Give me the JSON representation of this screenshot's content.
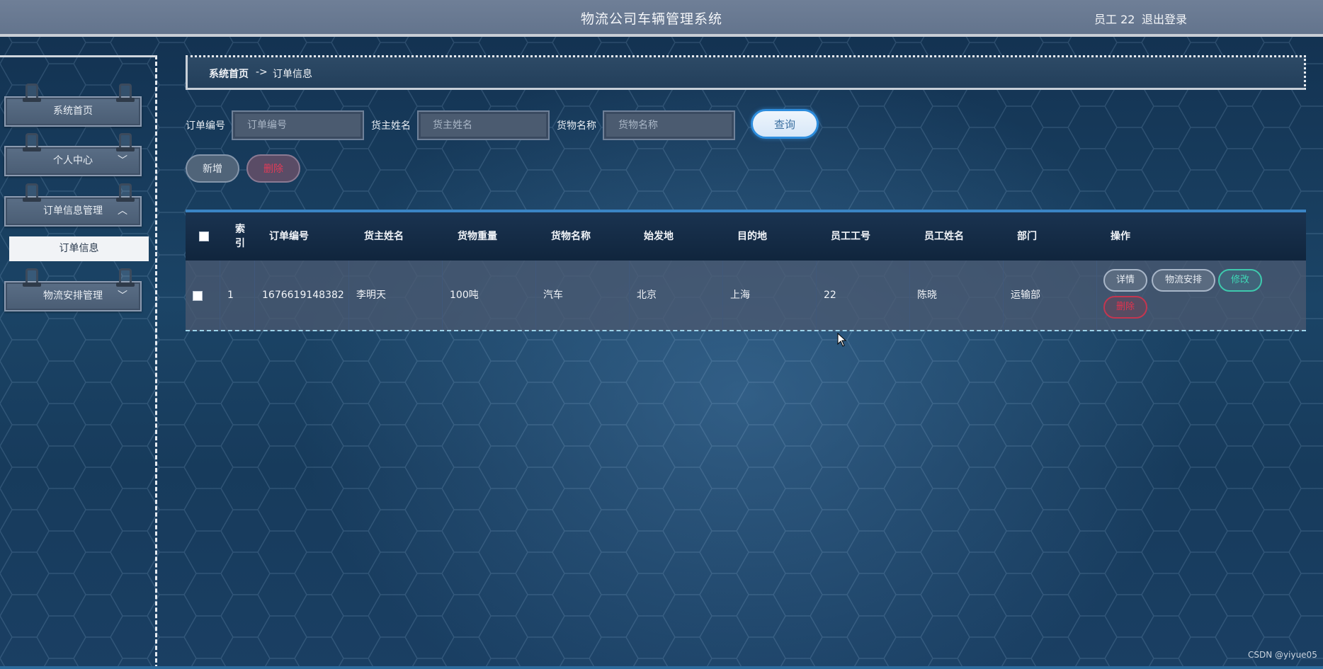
{
  "header": {
    "title": "物流公司车辆管理系统",
    "user": "员工 22",
    "logout": "退出登录"
  },
  "sidebar": {
    "items": [
      {
        "label": "系统首页"
      },
      {
        "label": "个人中心"
      },
      {
        "label": "订单信息管理"
      },
      {
        "label": "物流安排管理"
      }
    ],
    "sub_item": "订单信息"
  },
  "breadcrumb": {
    "home": "系统首页",
    "sep": "->",
    "current": "订单信息"
  },
  "search": {
    "order_no_label": "订单编号",
    "order_no_placeholder": "订单编号",
    "owner_label": "货主姓名",
    "owner_placeholder": "货主姓名",
    "goods_label": "货物名称",
    "goods_placeholder": "货物名称",
    "query": "查询"
  },
  "actions": {
    "add": "新增",
    "delete": "删除"
  },
  "table": {
    "headers": [
      "索引",
      "订单编号",
      "货主姓名",
      "货物重量",
      "货物名称",
      "始发地",
      "目的地",
      "员工工号",
      "员工姓名",
      "部门",
      "操作"
    ],
    "rows": [
      {
        "index": "1",
        "order_no": "1676619148382",
        "owner": "李明天",
        "weight": "100吨",
        "goods": "汽车",
        "origin": "北京",
        "destination": "上海",
        "emp_no": "22",
        "emp_name": "陈晓",
        "dept": "运输部",
        "ops": {
          "detail": "详情",
          "plan": "物流安排",
          "edit": "修改",
          "delete": "删除"
        }
      }
    ]
  },
  "watermark": "CSDN @yiyue05"
}
